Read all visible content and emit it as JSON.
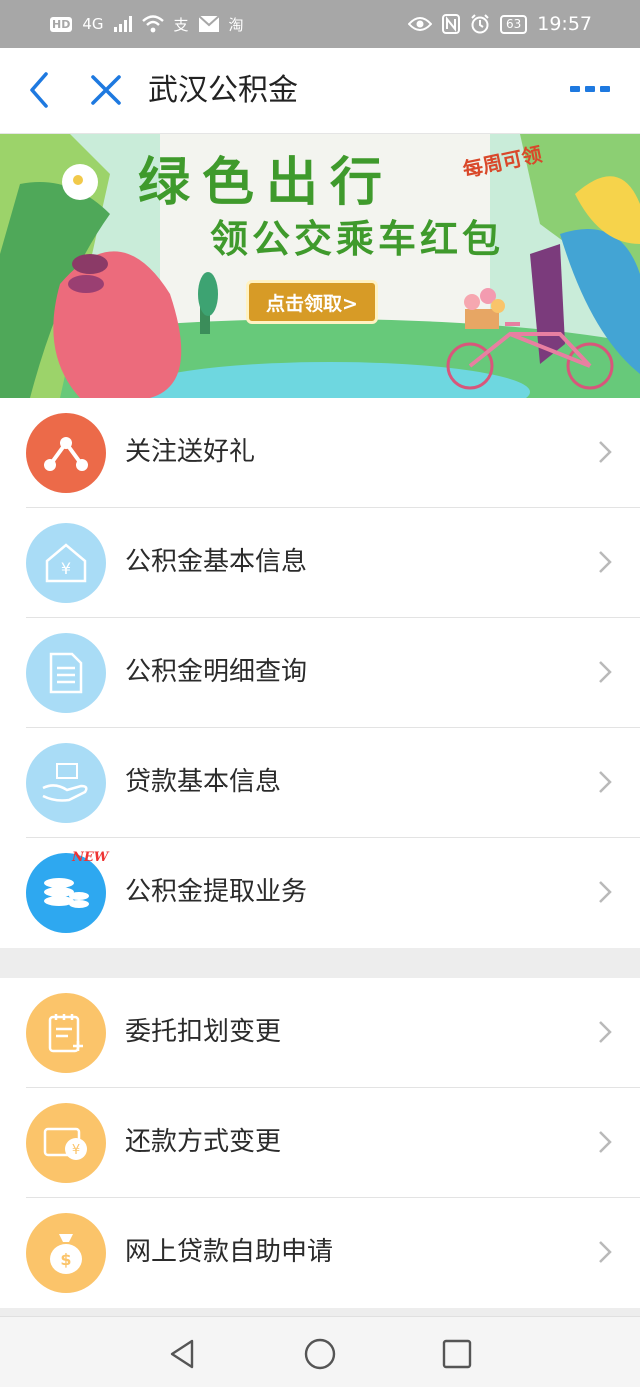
{
  "status_bar": {
    "left_chip": "HD",
    "network": "4G",
    "app1": "支",
    "app2": "淘",
    "battery": "63",
    "time": "19:57"
  },
  "nav": {
    "title": "武汉公积金"
  },
  "banner": {
    "title_line1": "绿色出行",
    "title_line2": "领公交乘车红包",
    "badge": "每周可领",
    "button_label": "点击领取>"
  },
  "menu_group_1": [
    {
      "label": "关注送好礼",
      "icon": "share-icon",
      "color": "#ec6a49"
    },
    {
      "label": "公积金基本信息",
      "icon": "house-yen-icon",
      "color": "#a9dcf6"
    },
    {
      "label": "公积金明细查询",
      "icon": "document-icon",
      "color": "#a9dcf6"
    },
    {
      "label": "贷款基本信息",
      "icon": "hand-money-icon",
      "color": "#a9dcf6"
    },
    {
      "label": "公积金提取业务",
      "icon": "coins-icon",
      "color": "#2ea8f0",
      "badge": "NEW"
    }
  ],
  "menu_group_2": [
    {
      "label": "委托扣划变更",
      "icon": "notepad-icon",
      "color": "#fbc46a"
    },
    {
      "label": "还款方式变更",
      "icon": "card-yen-icon",
      "color": "#fbc46a"
    },
    {
      "label": "网上贷款自助申请",
      "icon": "money-bag-icon",
      "color": "#fbc46a"
    }
  ]
}
